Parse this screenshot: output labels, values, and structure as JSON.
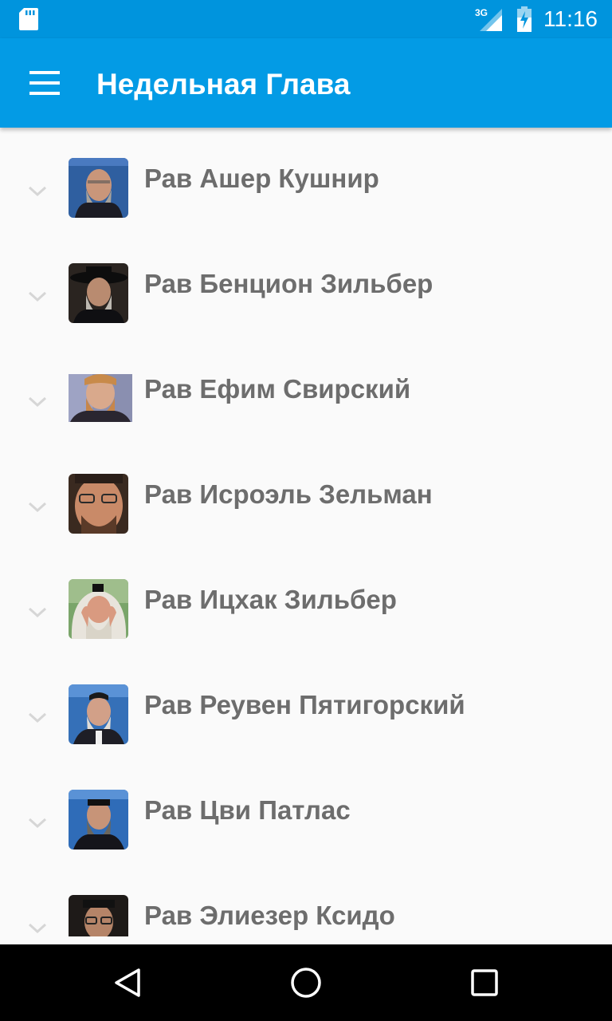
{
  "status_bar": {
    "time": "11:16",
    "network": "3G",
    "icons": [
      "sd-card-icon",
      "signal-icon",
      "battery-charging-icon"
    ]
  },
  "app_bar": {
    "title": "Недельная Глава",
    "menu_icon": "hamburger-menu-icon"
  },
  "list": {
    "items": [
      {
        "label": "Рав Ашер Кушнир"
      },
      {
        "label": "Рав Бенцион Зильбер"
      },
      {
        "label": " Рав Ефим Свирский"
      },
      {
        "label": "Рав Исроэль Зельман"
      },
      {
        "label": "Рав Ицхак Зильбер"
      },
      {
        "label": "Рав Реувен Пятигорский"
      },
      {
        "label": "Рав Цви Патлас"
      },
      {
        "label": "Рав Элиезер Ксидо"
      }
    ]
  },
  "nav_bar": {
    "icons": [
      "back-icon",
      "home-icon",
      "recents-icon"
    ]
  },
  "colors": {
    "status_bar": "#0094dd",
    "app_bar": "#039be5",
    "list_background": "#fafafa",
    "label_text": "#6d6d6d"
  }
}
